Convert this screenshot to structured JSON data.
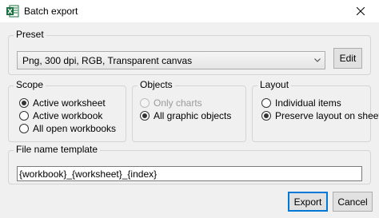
{
  "window": {
    "title": "Batch export",
    "app_icon": "excel-icon",
    "close_icon": "close-icon"
  },
  "preset": {
    "label": "Preset",
    "selected_value": "Png, 300 dpi, RGB, Transparent canvas",
    "edit_label": "Edit"
  },
  "scope": {
    "label": "Scope",
    "options": [
      {
        "label": "Active worksheet",
        "checked": true,
        "enabled": true
      },
      {
        "label": "Active workbook",
        "checked": false,
        "enabled": true
      },
      {
        "label": "All open workbooks",
        "checked": false,
        "enabled": true
      }
    ]
  },
  "objects": {
    "label": "Objects",
    "options": [
      {
        "label": "Only charts",
        "checked": false,
        "enabled": false
      },
      {
        "label": "All graphic objects",
        "checked": true,
        "enabled": true
      }
    ]
  },
  "layout": {
    "label": "Layout",
    "options": [
      {
        "label": "Individual items",
        "checked": false,
        "enabled": true
      },
      {
        "label": "Preserve layout on sheet",
        "checked": true,
        "enabled": true
      }
    ]
  },
  "file_name": {
    "label": "File name template",
    "value": "{workbook}_{worksheet}_{index}"
  },
  "footer": {
    "export_label": "Export",
    "cancel_label": "Cancel"
  },
  "colors": {
    "excel_green": "#1d6f42",
    "focus_blue": "#0078d7"
  }
}
